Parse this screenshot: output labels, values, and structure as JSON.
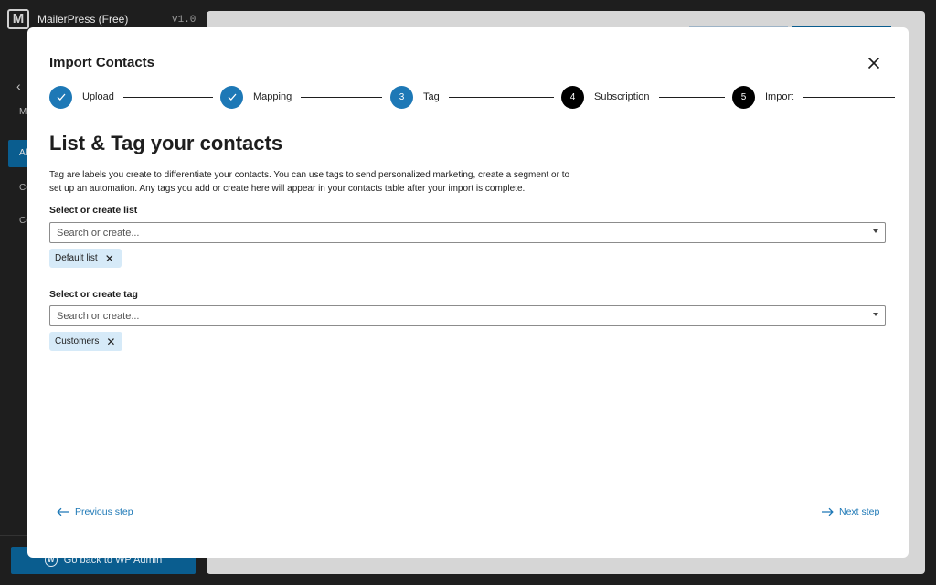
{
  "app": {
    "name": "MailerPress (Free)",
    "version": "v1.0",
    "logo_letter": "M",
    "wp_admin_label": "Go back to WP Admin",
    "wp_icon_letter": "W"
  },
  "modal": {
    "title": "Import Contacts",
    "steps": [
      {
        "label": "Upload",
        "number": "1",
        "status": "done"
      },
      {
        "label": "Mapping",
        "number": "2",
        "status": "done"
      },
      {
        "label": "Tag",
        "number": "3",
        "status": "current"
      },
      {
        "label": "Subscription",
        "number": "4",
        "status": "pending"
      },
      {
        "label": "Import",
        "number": "5",
        "status": "pending"
      }
    ],
    "heading": "List & Tag your contacts",
    "description": "Tag are labels you create to differentiate your contacts. You can use tags to send personalized marketing, create a segment or to set up an automation. Any tags you add or create here will appear in your contacts table after your import is complete.",
    "list_field": {
      "label": "Select or create list",
      "placeholder": "Search or create...",
      "selected": [
        "Default list"
      ]
    },
    "tag_field": {
      "label": "Select or create tag",
      "placeholder": "Search or create...",
      "selected": [
        "Customers"
      ]
    },
    "previous_label": "Previous step",
    "next_label": "Next step"
  },
  "colors": {
    "accent": "#1d78b6",
    "chip_bg": "#d6eaf8",
    "sidebar_active": "#0a5d8f"
  },
  "icons": {
    "close": "close-icon",
    "check": "check-icon",
    "caret": "chevron-down-icon",
    "prev": "arrow-left-icon",
    "next": "arrow-right-icon"
  }
}
